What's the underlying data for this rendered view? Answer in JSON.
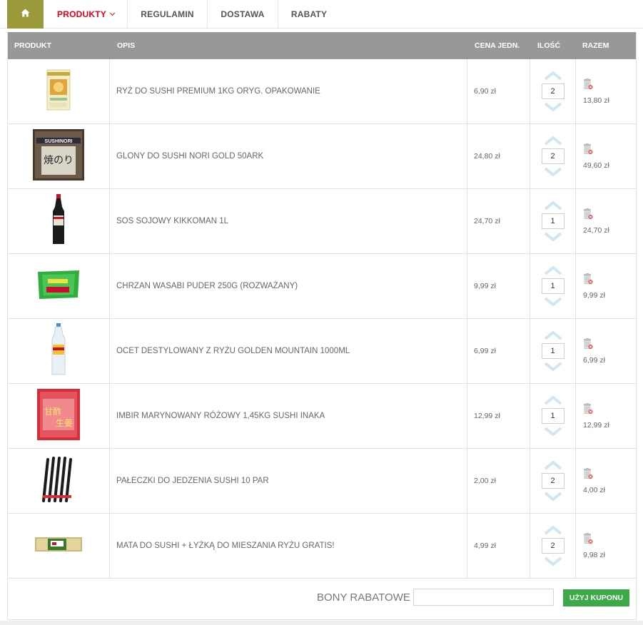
{
  "nav": {
    "home_icon": "home-icon",
    "items": [
      {
        "label": "PRODUKTY",
        "active": true,
        "dropdown": true
      },
      {
        "label": "REGULAMIN"
      },
      {
        "label": "DOSTAWA"
      },
      {
        "label": "RABATY"
      }
    ]
  },
  "table": {
    "headers": {
      "product": "PRODUKT",
      "description": "OPIS",
      "unit_price": "CENA JEDN.",
      "quantity": "ILOŚĆ",
      "total": "RAZEM"
    },
    "rows": [
      {
        "image": "rice-package-image",
        "description": "RYŻ DO SUSHI PREMIUM 1KG ORYG. OPAKOWANIE",
        "unit_price": "6,90 zł",
        "quantity": "2",
        "total": "13,80 zł"
      },
      {
        "image": "nori-package-image",
        "description": "GLONY DO SUSHI NORI GOLD 50ARK",
        "unit_price": "24,80 zł",
        "quantity": "2",
        "total": "49,60 zł"
      },
      {
        "image": "soy-sauce-bottle-image",
        "description": "SOS SOJOWY KIKKOMAN 1L",
        "unit_price": "24,70 zł",
        "quantity": "1",
        "total": "24,70 zł"
      },
      {
        "image": "wasabi-package-image",
        "description": "CHRZAN WASABI PUDER 250G (ROZWAŻANY)",
        "unit_price": "9,99 zł",
        "quantity": "1",
        "total": "9,99 zł"
      },
      {
        "image": "vinegar-bottle-image",
        "description": "OCET DESTYLOWANY Z RYŻU GOLDEN MOUNTAIN 1000ML",
        "unit_price": "6,99 zł",
        "quantity": "1",
        "total": "6,99 zł"
      },
      {
        "image": "ginger-package-image",
        "description": "IMBIR MARYNOWANY RÓŻOWY 1,45KG SUSHI INAKA",
        "unit_price": "12,99 zł",
        "quantity": "1",
        "total": "12,99 zł"
      },
      {
        "image": "chopsticks-image",
        "description": "PAŁECZKI DO JEDZENIA SUSHI 10 PAR",
        "unit_price": "2,00 zł",
        "quantity": "2",
        "total": "4,00 zł"
      },
      {
        "image": "sushi-mat-image",
        "description": "MATA DO SUSHI + ŁYŻKĄ DO MIESZANIA RYŻU GRATIS!",
        "unit_price": "4,99 zł",
        "quantity": "2",
        "total": "9,98 zł"
      }
    ]
  },
  "coupon": {
    "label": "BONY RABATOWE",
    "input_value": "",
    "button_label": "UŻYJ KUPONU"
  },
  "colors": {
    "home_bg": "#9a9a3a",
    "active_nav": "#e3001b",
    "header_bg": "#989898",
    "coupon_button": "#3daa4a",
    "arrow": "#cfe6f3"
  }
}
